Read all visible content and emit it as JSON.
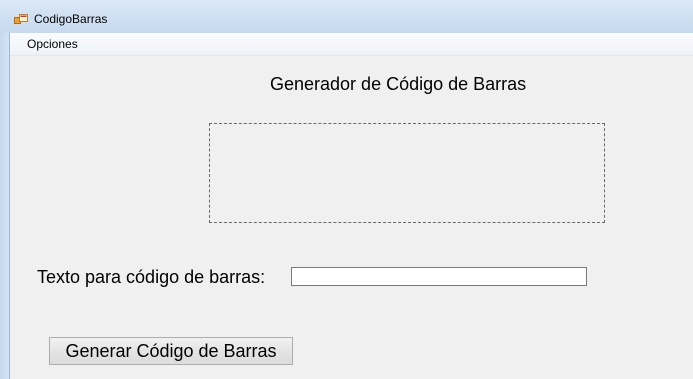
{
  "window": {
    "title": "CodigoBarras",
    "icon": "winforms-app-icon"
  },
  "menubar": {
    "items": [
      {
        "label": "Opciones"
      }
    ]
  },
  "main": {
    "heading": "Generador de Código de Barras",
    "barcode_area": {
      "content": ""
    },
    "text_field": {
      "label": "Texto para código de barras:",
      "value": "",
      "placeholder": ""
    },
    "generate_button": {
      "label": "Generar Código de Barras"
    }
  },
  "colors": {
    "titlebar": "#c6d9ee",
    "client_background": "#f0f0f0",
    "menubar": "#f5f8fc"
  }
}
